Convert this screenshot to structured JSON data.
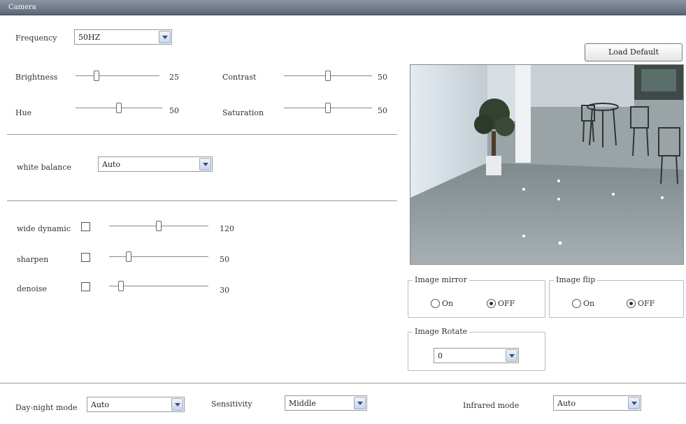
{
  "window": {
    "title": "Camera"
  },
  "frequency": {
    "label": "Frequency",
    "value": "50HZ"
  },
  "load_default": "Load Default",
  "image_controls": {
    "brightness": {
      "label": "Brightness",
      "value": "25",
      "level": 25
    },
    "contrast": {
      "label": "Contrast",
      "value": "50",
      "level": 50
    },
    "hue": {
      "label": "Hue",
      "value": "50",
      "level": 50
    },
    "saturation": {
      "label": "Saturation",
      "value": "50",
      "level": 50
    }
  },
  "white_balance": {
    "label": "white balance",
    "value": "Auto"
  },
  "enhancements": {
    "wide_dynamic": {
      "label": "wide dynamic",
      "value": "120",
      "level": 50,
      "checked": false
    },
    "sharpen": {
      "label": "sharpen",
      "value": "50",
      "level": 20,
      "checked": false
    },
    "denoise": {
      "label": "denoise",
      "value": "30",
      "level": 12,
      "checked": false
    }
  },
  "image_mirror": {
    "label": "Image mirror",
    "on_label": "On",
    "off_label": "OFF",
    "selected": "OFF"
  },
  "image_flip": {
    "label": "Image flip",
    "on_label": "On",
    "off_label": "OFF",
    "selected": "OFF"
  },
  "image_rotate": {
    "label": "Image Rotate",
    "value": "0"
  },
  "day_night": {
    "label": "Day-night mode",
    "value": "Auto"
  },
  "sensitivity": {
    "label": "Sensitivity",
    "value": "Middle"
  },
  "infrared": {
    "label": "Infrared mode",
    "value": "Auto"
  },
  "icons": {
    "dropdown": "chevron-down-icon",
    "preview": "camera-preview-image"
  },
  "colors": {
    "titlebar": "#5b6677",
    "dropdown_arrow": "#3a4f78"
  }
}
